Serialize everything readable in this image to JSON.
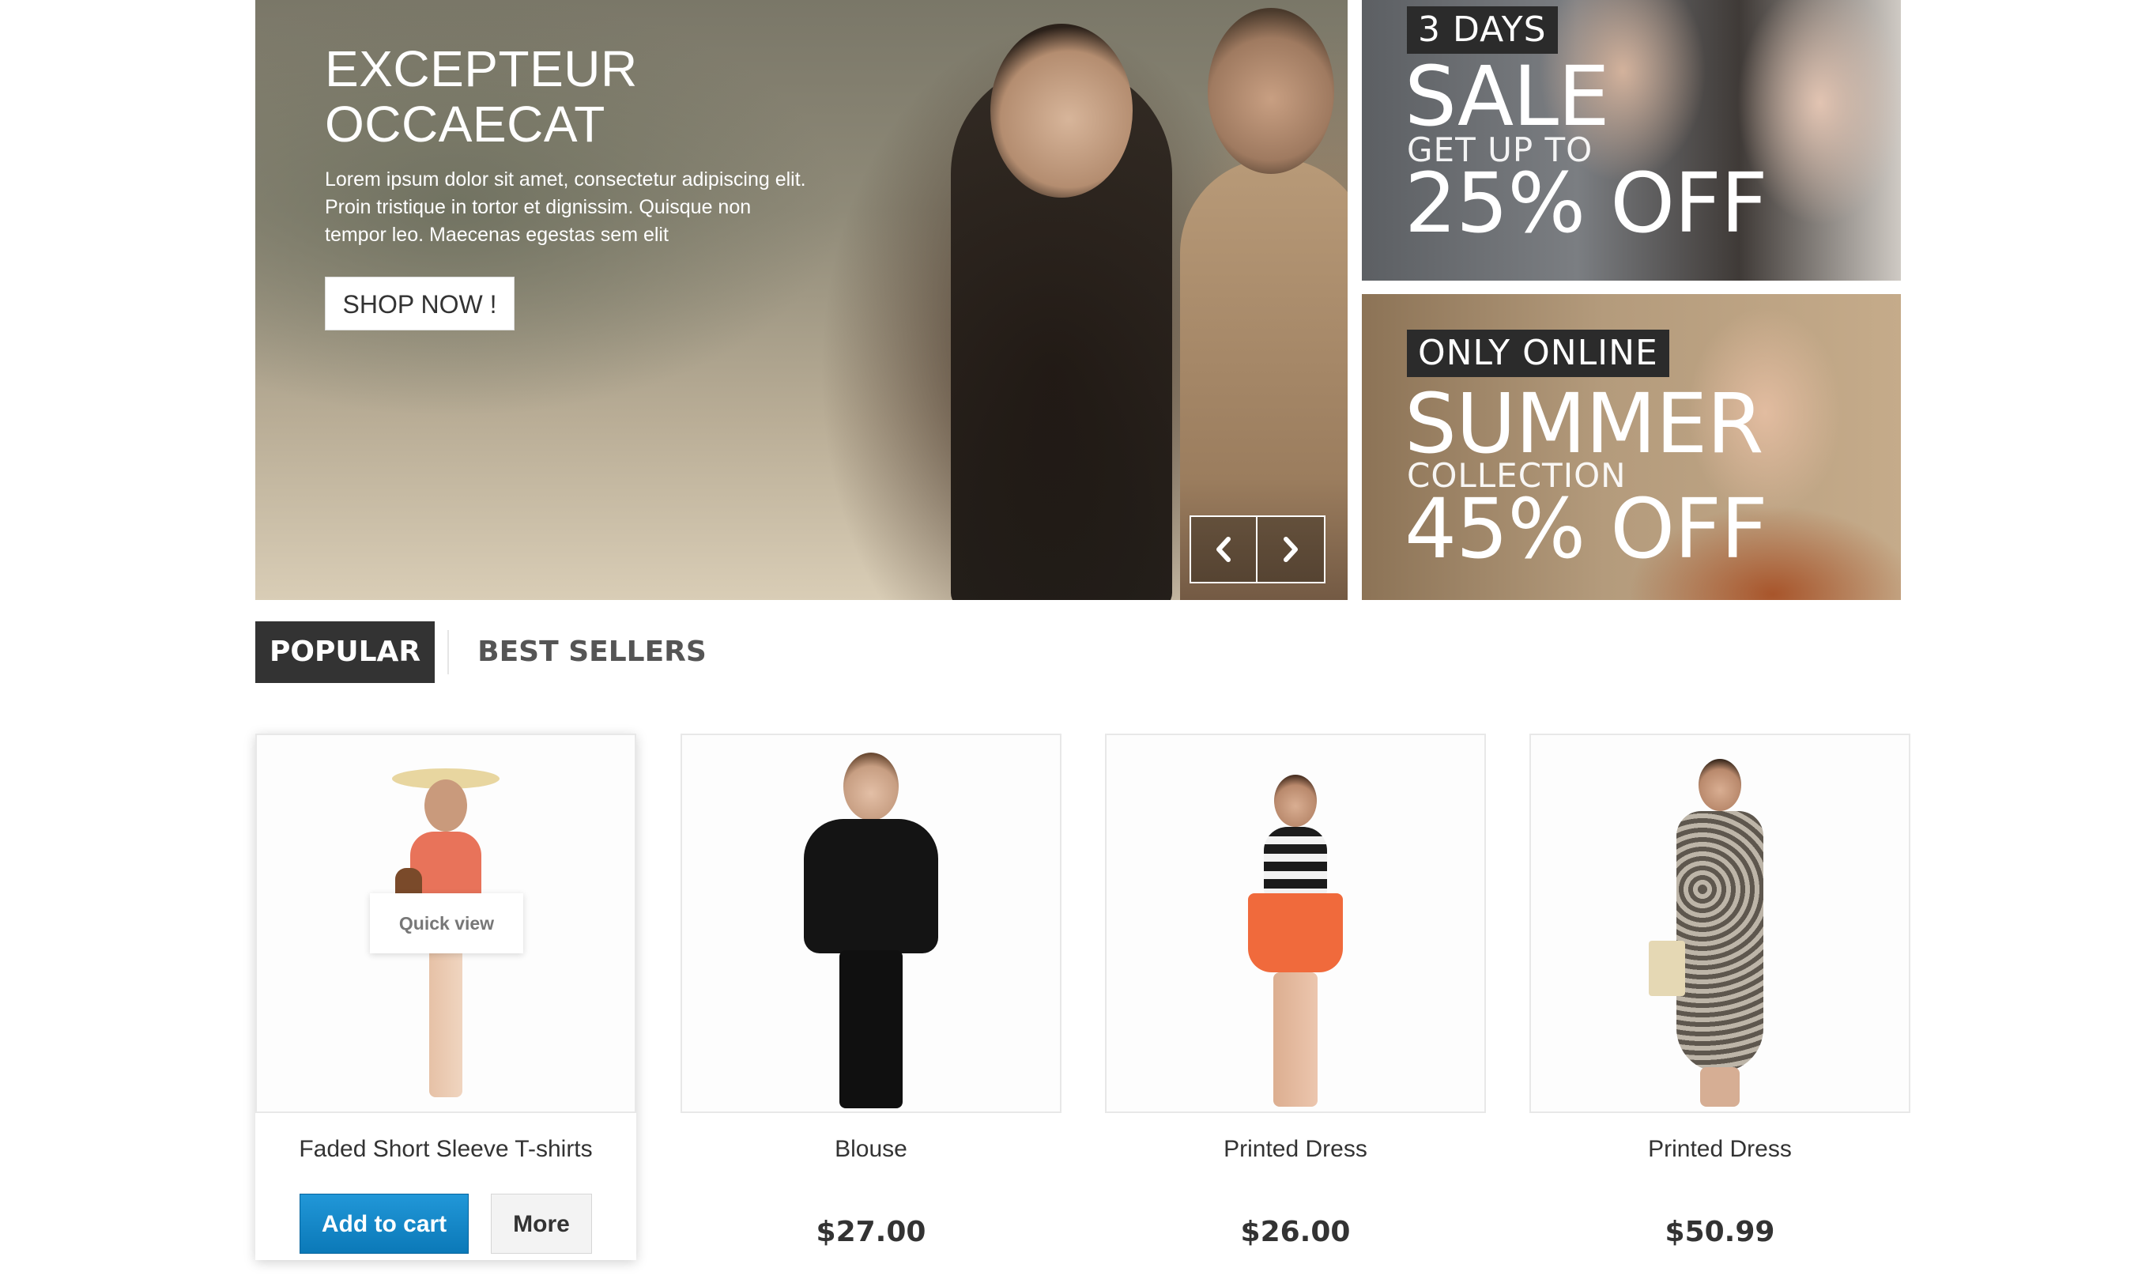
{
  "hero": {
    "title_line1": "EXCEPTEUR",
    "title_line2": "OCCAECAT",
    "text": "Lorem ipsum dolor sit amet, consectetur adipiscing elit. Proin tristique in tortor et dignissim. Quisque non tempor leo. Maecenas egestas sem elit",
    "button": "SHOP NOW !",
    "prev_icon": "chevron-left-icon",
    "next_icon": "chevron-right-icon"
  },
  "promos": [
    {
      "tag": "3 DAYS",
      "big1": "SALE",
      "mid": "GET UP TO",
      "big2": "25% OFF"
    },
    {
      "tag": "ONLY ONLINE",
      "big1": "SUMMER",
      "mid": "COLLECTION",
      "big2": "45% OFF"
    }
  ],
  "tabs": [
    {
      "label": "POPULAR",
      "active": true
    },
    {
      "label": "BEST SELLERS",
      "active": false
    }
  ],
  "products": [
    {
      "name": "Faded Short Sleeve T-shirts",
      "price": "",
      "quick_view": "Quick view",
      "add_to_cart": "Add to cart",
      "more": "More"
    },
    {
      "name": "Blouse",
      "price": "$27.00"
    },
    {
      "name": "Printed Dress",
      "price": "$26.00"
    },
    {
      "name": "Printed Dress",
      "price": "$50.99"
    }
  ],
  "colors": {
    "accent_blue": "#0d84c5",
    "tab_active_bg": "#333333",
    "promo_tag_bg": "#2b2b2b"
  }
}
